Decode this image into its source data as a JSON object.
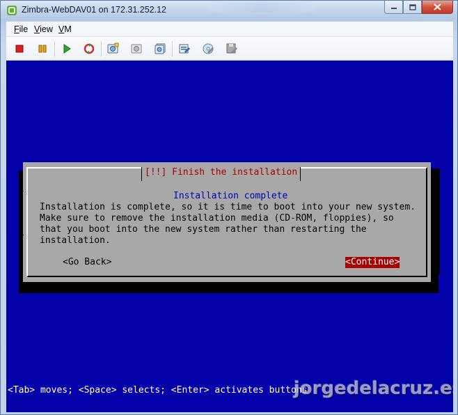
{
  "window": {
    "title": "Zimbra-WebDAV01 on 172.31.252.12",
    "icon": "vmware-icon",
    "controls": [
      "minimize-icon",
      "maximize-icon",
      "close-icon"
    ]
  },
  "menubar": {
    "items": [
      {
        "first": "F",
        "rest": "ile"
      },
      {
        "first": "V",
        "rest": "iew"
      },
      {
        "first": "V",
        "rest": "M"
      }
    ]
  },
  "toolbar": {
    "icons": [
      "stop-icon",
      "pause-icon",
      "play-icon",
      "reset-icon",
      "take-snapshot-icon",
      "revert-snapshot-icon",
      "snapshot-manager-icon",
      "edit-settings-icon",
      "cd-dvd-icon",
      "floppy-icon"
    ]
  },
  "dialog": {
    "title": "[!!] Finish the installation",
    "subtitle": "Installation complete",
    "lines": [
      "Installation is complete, so it is time to boot into your new system.",
      "Make sure to remove the installation media (CD-ROM, floppies), so",
      "that you boot into the new system rather than restarting the",
      "installation."
    ],
    "go_back": "<Go Back>",
    "continue": "<Continue>"
  },
  "status_line": "<Tab> moves; <Space> selects; <Enter> activates buttons",
  "watermark": "jorgedelacruz.es",
  "colors": {
    "console_bg": "#0202a8",
    "dialog_bg": "#a8a8a8",
    "title_red": "#a80000",
    "subtitle_blue": "#0000a8",
    "selected_bg": "#a80000"
  }
}
